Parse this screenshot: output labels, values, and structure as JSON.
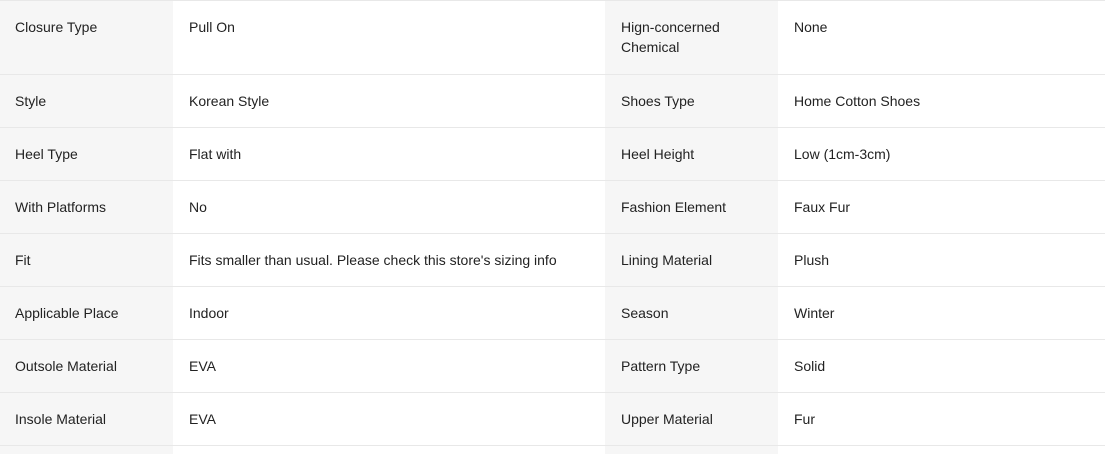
{
  "specs": {
    "rows": [
      {
        "label_left": "Closure Type",
        "value_left": "Pull On",
        "label_right": "Hign-concerned Chemical",
        "value_right": "None"
      },
      {
        "label_left": "Style",
        "value_left": "Korean Style",
        "label_right": "Shoes Type",
        "value_right": "Home Cotton Shoes"
      },
      {
        "label_left": "Heel Type",
        "value_left": "Flat with",
        "label_right": "Heel Height",
        "value_right": "Low (1cm-3cm)"
      },
      {
        "label_left": "With Platforms",
        "value_left": "No",
        "label_right": "Fashion Element",
        "value_right": "Faux Fur"
      },
      {
        "label_left": "Fit",
        "value_left": "Fits smaller than usual. Please check this store's sizing info",
        "label_right": "Lining Material",
        "value_right": "Plush"
      },
      {
        "label_left": "Applicable Place",
        "value_left": "Indoor",
        "label_right": "Season",
        "value_right": "Winter"
      },
      {
        "label_left": "Outsole Material",
        "value_left": "EVA",
        "label_right": "Pattern Type",
        "value_right": "Solid"
      },
      {
        "label_left": "Insole Material",
        "value_left": "EVA",
        "label_right": "Upper Material",
        "value_right": "Fur"
      }
    ]
  },
  "colors": {
    "label_bg": "#f6f6f6",
    "value_bg": "#ffffff",
    "divider": "#e8e8e8",
    "text": "#222222"
  }
}
